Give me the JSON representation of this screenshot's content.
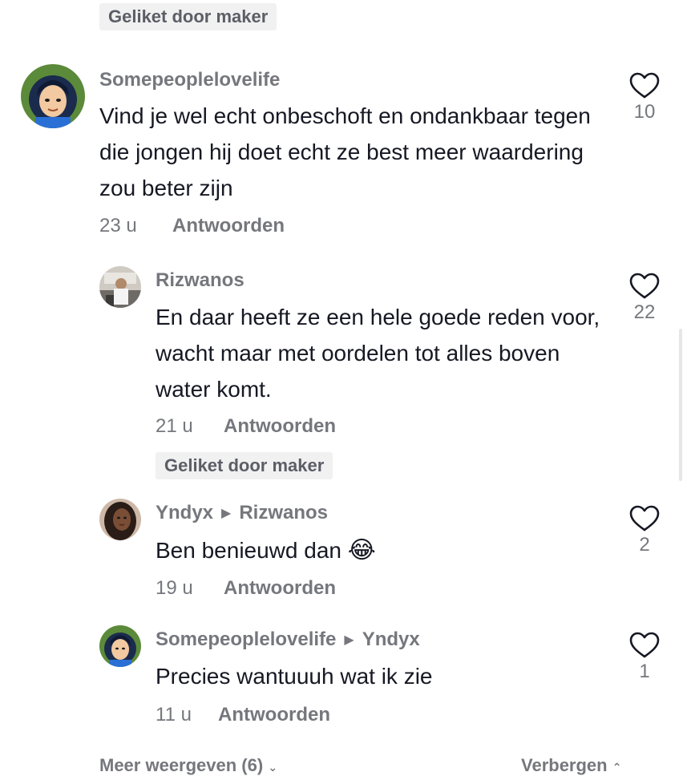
{
  "badge_top": "Geliket door maker",
  "comments": [
    {
      "username": "Somepeoplelovelife",
      "text": "Vind je wel echt onbeschoft en ondankbaar tegen die jongen hij doet echt ze best meer waardering zou beter zijn",
      "time": "23 u",
      "reply_label": "Antwoorden",
      "likes": "10"
    },
    {
      "username": "Rizwanos",
      "text": "En daar heeft ze een hele goede reden voor, wacht maar met oordelen tot alles boven water komt.",
      "time": "21 u",
      "reply_label": "Antwoorden",
      "likes": "22",
      "badge": "Geliket door maker"
    },
    {
      "username": "Yndyx",
      "reply_to": "Rizwanos",
      "text": "Ben benieuwd dan",
      "emoji": "😂",
      "time": "19 u",
      "reply_label": "Antwoorden",
      "likes": "2"
    },
    {
      "username": "Somepeoplelovelife",
      "reply_to": "Yndyx",
      "text": "Precies wantuuuh wat ik zie",
      "time": "11 u",
      "reply_label": "Antwoorden",
      "likes": "1"
    }
  ],
  "footer": {
    "more_label": "Meer weergeven (6)",
    "hide_label": "Verbergen"
  },
  "icons": {
    "like": "heart-outline-icon",
    "reply_arrow": "triangle-right-icon",
    "more": "chevron-down-icon",
    "hide": "chevron-up-icon"
  },
  "colors": {
    "text": "#161823",
    "muted": "#75777d",
    "badge_bg": "#f1f1f2"
  }
}
